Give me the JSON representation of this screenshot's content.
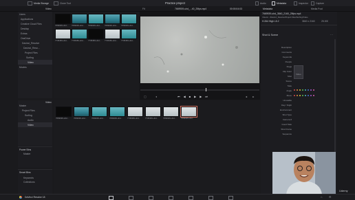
{
  "topbar": {
    "media_storage": "Media Storage",
    "clone_tool": "Clone Tool",
    "project_title": "Practice project",
    "audio": "Audio",
    "metadata": "Metadata",
    "inspector": "Inspector",
    "capture": "Capture"
  },
  "toolbar2": {
    "video_label": "Video",
    "fit_label": "Fit",
    "clip_name": "7669939-uhd_...40_25fps.mp4",
    "timecode": "00:00:04:03",
    "metadata_tab": "Metadata",
    "media_pool_tab": "Media Pool"
  },
  "storage_tree": [
    "Users",
    "Applications",
    "Creative Cloud Files",
    "Desktop",
    "Extras",
    "OneDrive",
    "Davinci_Resolve",
    "Davinci_Reso...",
    "Project Files",
    "Surfing",
    "Video",
    "Movies"
  ],
  "storage_thumbs": [
    "7669939-uhd...",
    "7669939-uhd...",
    "7669939-uhd...",
    "7669939-uhd...",
    "7669939-uhd...",
    "7735383-uhd...",
    "7735383-uhd...",
    "7735383-uhd...",
    "7735383-uhd...",
    "7735383-uhd..."
  ],
  "pool_tree": [
    "Master",
    "Project Files",
    "Surfing",
    "Audio",
    "Video"
  ],
  "pool_header": "Video",
  "pool_thumbs": [
    "7669939-uhd...",
    "7669939-uhd...",
    "7669939-uhd...",
    "7669939-uhd...",
    "7735383-uhd...",
    "7735383-uhd...",
    "7669939-uhd...",
    "7669939-uhd..."
  ],
  "power_bins": {
    "header": "Power Bins",
    "item": "Master"
  },
  "smart_bins": {
    "header": "Smart Bins",
    "items": [
      "Keywords",
      "Collections"
    ]
  },
  "metadata": {
    "clip_name": "7669939-uhd_3840_2160_25fps.mp4",
    "clip_sub": "/Users/.../Davinci_Resolve/Project Files/Surfing/Video",
    "codec": "H.264 High L5.2",
    "res": "3840 x 2160",
    "fps": "25.000",
    "section": "Shot & Scene",
    "fields": [
      "Description",
      "Comments",
      "Keywords",
      "People",
      "Flags",
      "Clip Color",
      "Shot",
      "Scene",
      "Take",
      "Angle",
      "Move",
      "Unusable",
      "Day / Night",
      "Environment",
      "Shot Type",
      "Camera #",
      "Good Take",
      "Shot Frame",
      "Sequence"
    ],
    "keywords_chip": "Video"
  },
  "bottombar": {
    "app_name": "DaVinci Resolve 18"
  },
  "watermark": "Udemy",
  "colors": {
    "accent": "#d2483c",
    "panel": "#1e1e22",
    "bg": "#1a1a1d"
  }
}
